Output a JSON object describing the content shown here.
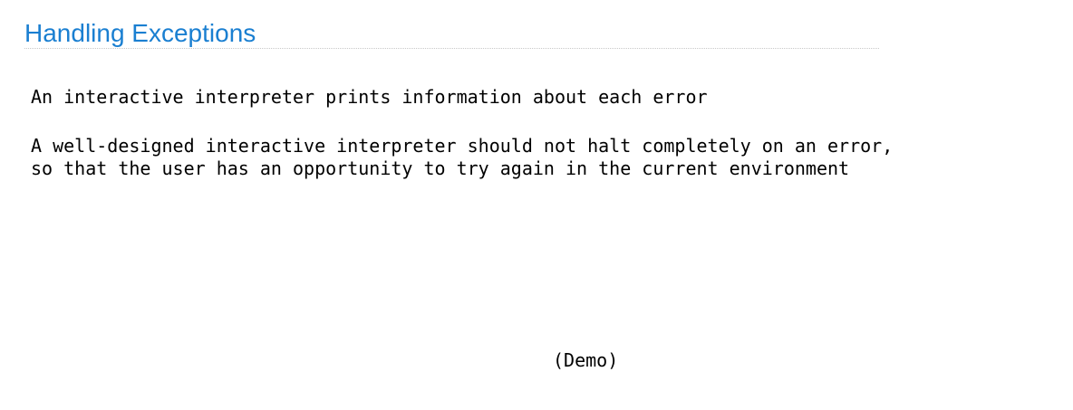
{
  "slide": {
    "title": "Handling Exceptions",
    "paragraph_1": "An interactive interpreter prints information about each error",
    "paragraph_2_line_1": "A well-designed interactive interpreter should not halt completely on an error,",
    "paragraph_2_line_2": "so that the user has an opportunity to try again in the current environment",
    "demo_label": "(Demo)"
  },
  "colors": {
    "title": "#1a7fd1",
    "text": "#000000",
    "rule": "#c8c8c8",
    "background": "#ffffff"
  }
}
